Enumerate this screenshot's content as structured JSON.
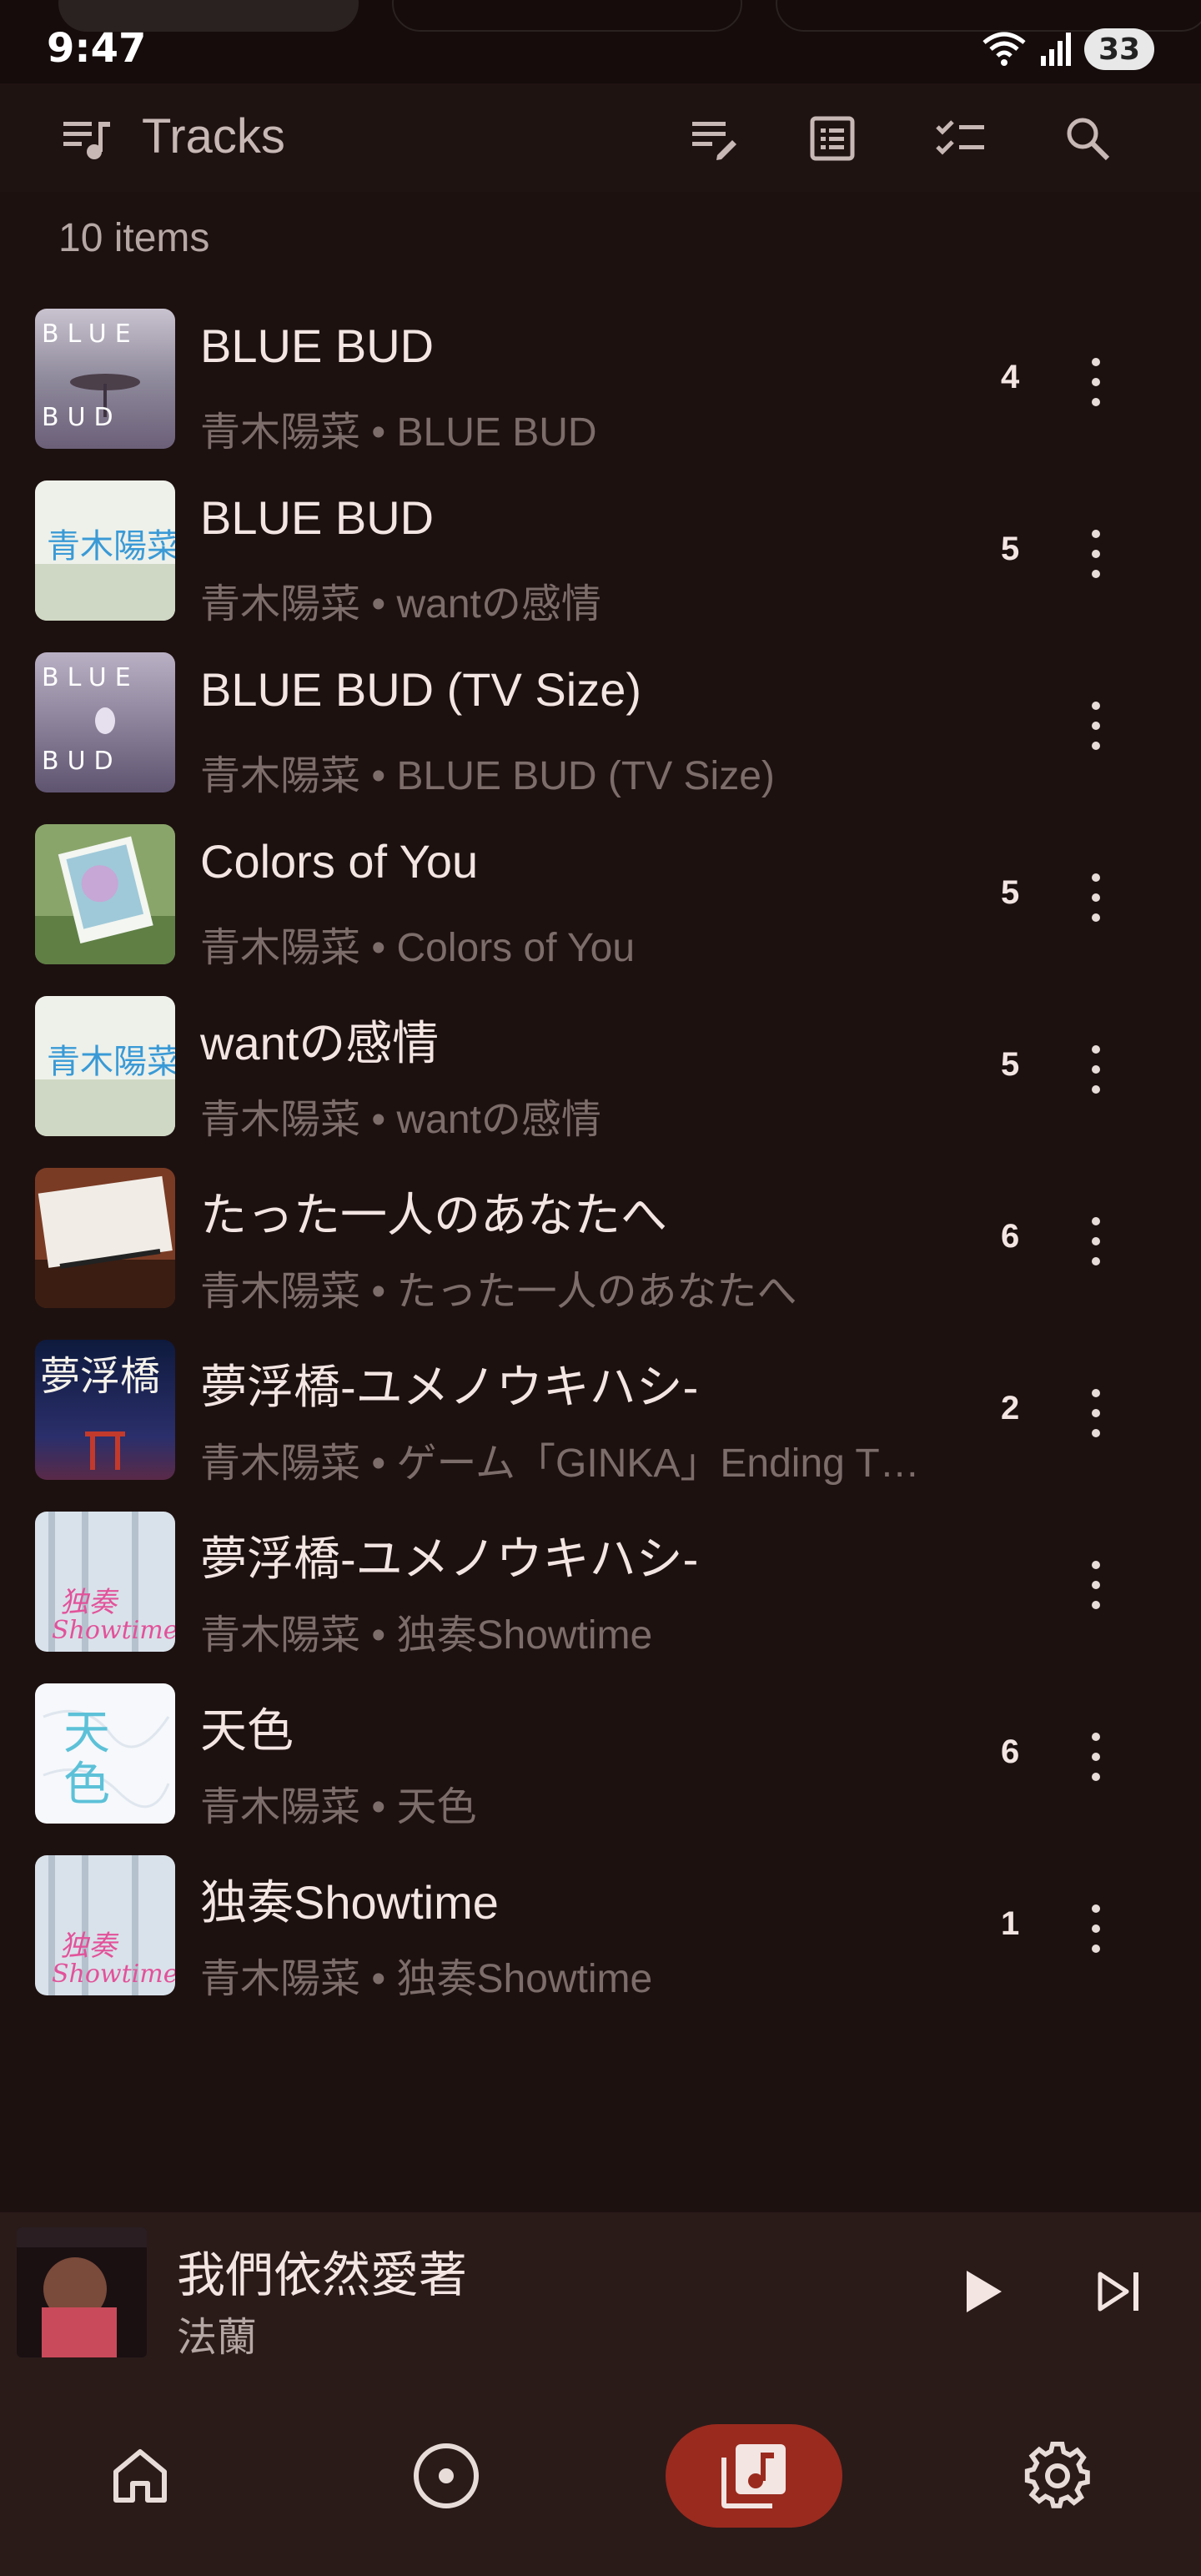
{
  "status_bar": {
    "time": "9:47",
    "battery": "33",
    "icons": [
      "wifi-icon",
      "signal-icon",
      "battery-icon"
    ]
  },
  "app_bar": {
    "title": "Tracks",
    "title_icon": "music-list-icon",
    "actions": [
      "edit-queue-icon",
      "list-view-icon",
      "select-icon",
      "search-icon"
    ]
  },
  "list": {
    "count_label": "10 items"
  },
  "tracks": [
    {
      "title": "BLUE BUD",
      "subtitle": "青木陽菜 • BLUE BUD",
      "number": "4",
      "art": "blue-bud"
    },
    {
      "title": "BLUE BUD",
      "subtitle": "青木陽菜 • wantの感情",
      "number": "5",
      "art": "want"
    },
    {
      "title": "BLUE BUD (TV Size)",
      "subtitle": "青木陽菜 • BLUE BUD (TV Size)",
      "number": "",
      "art": "blue-bud"
    },
    {
      "title": "Colors of You",
      "subtitle": "青木陽菜 • Colors of You",
      "number": "5",
      "art": "colors"
    },
    {
      "title": "wantの感情",
      "subtitle": "青木陽菜 • wantの感情",
      "number": "5",
      "art": "want"
    },
    {
      "title": "たった一人のあなたへ",
      "subtitle": "青木陽菜 • たった一人のあなたへ",
      "number": "6",
      "art": "letter"
    },
    {
      "title": "夢浮橋-ユメノウキハシ-",
      "subtitle": "青木陽菜 • ゲーム「GINKA」Ending T…",
      "number": "2",
      "art": "yume"
    },
    {
      "title": "夢浮橋-ユメノウキハシ-",
      "subtitle": "青木陽菜 • 独奏Showtime",
      "number": "",
      "art": "showtime"
    },
    {
      "title": "天色",
      "subtitle": "青木陽菜 • 天色",
      "number": "6",
      "art": "amairo"
    },
    {
      "title": "独奏Showtime",
      "subtitle": "青木陽菜 • 独奏Showtime",
      "number": "1",
      "art": "showtime"
    }
  ],
  "mini_player": {
    "title": "我們依然愛著",
    "artist": "法蘭"
  },
  "bottom_nav": [
    "home-icon",
    "disc-icon",
    "library-icon",
    "settings-icon"
  ],
  "colors": {
    "background": "#1d1110",
    "accent": "#9a2a1e",
    "panel": "#2a1b19"
  }
}
